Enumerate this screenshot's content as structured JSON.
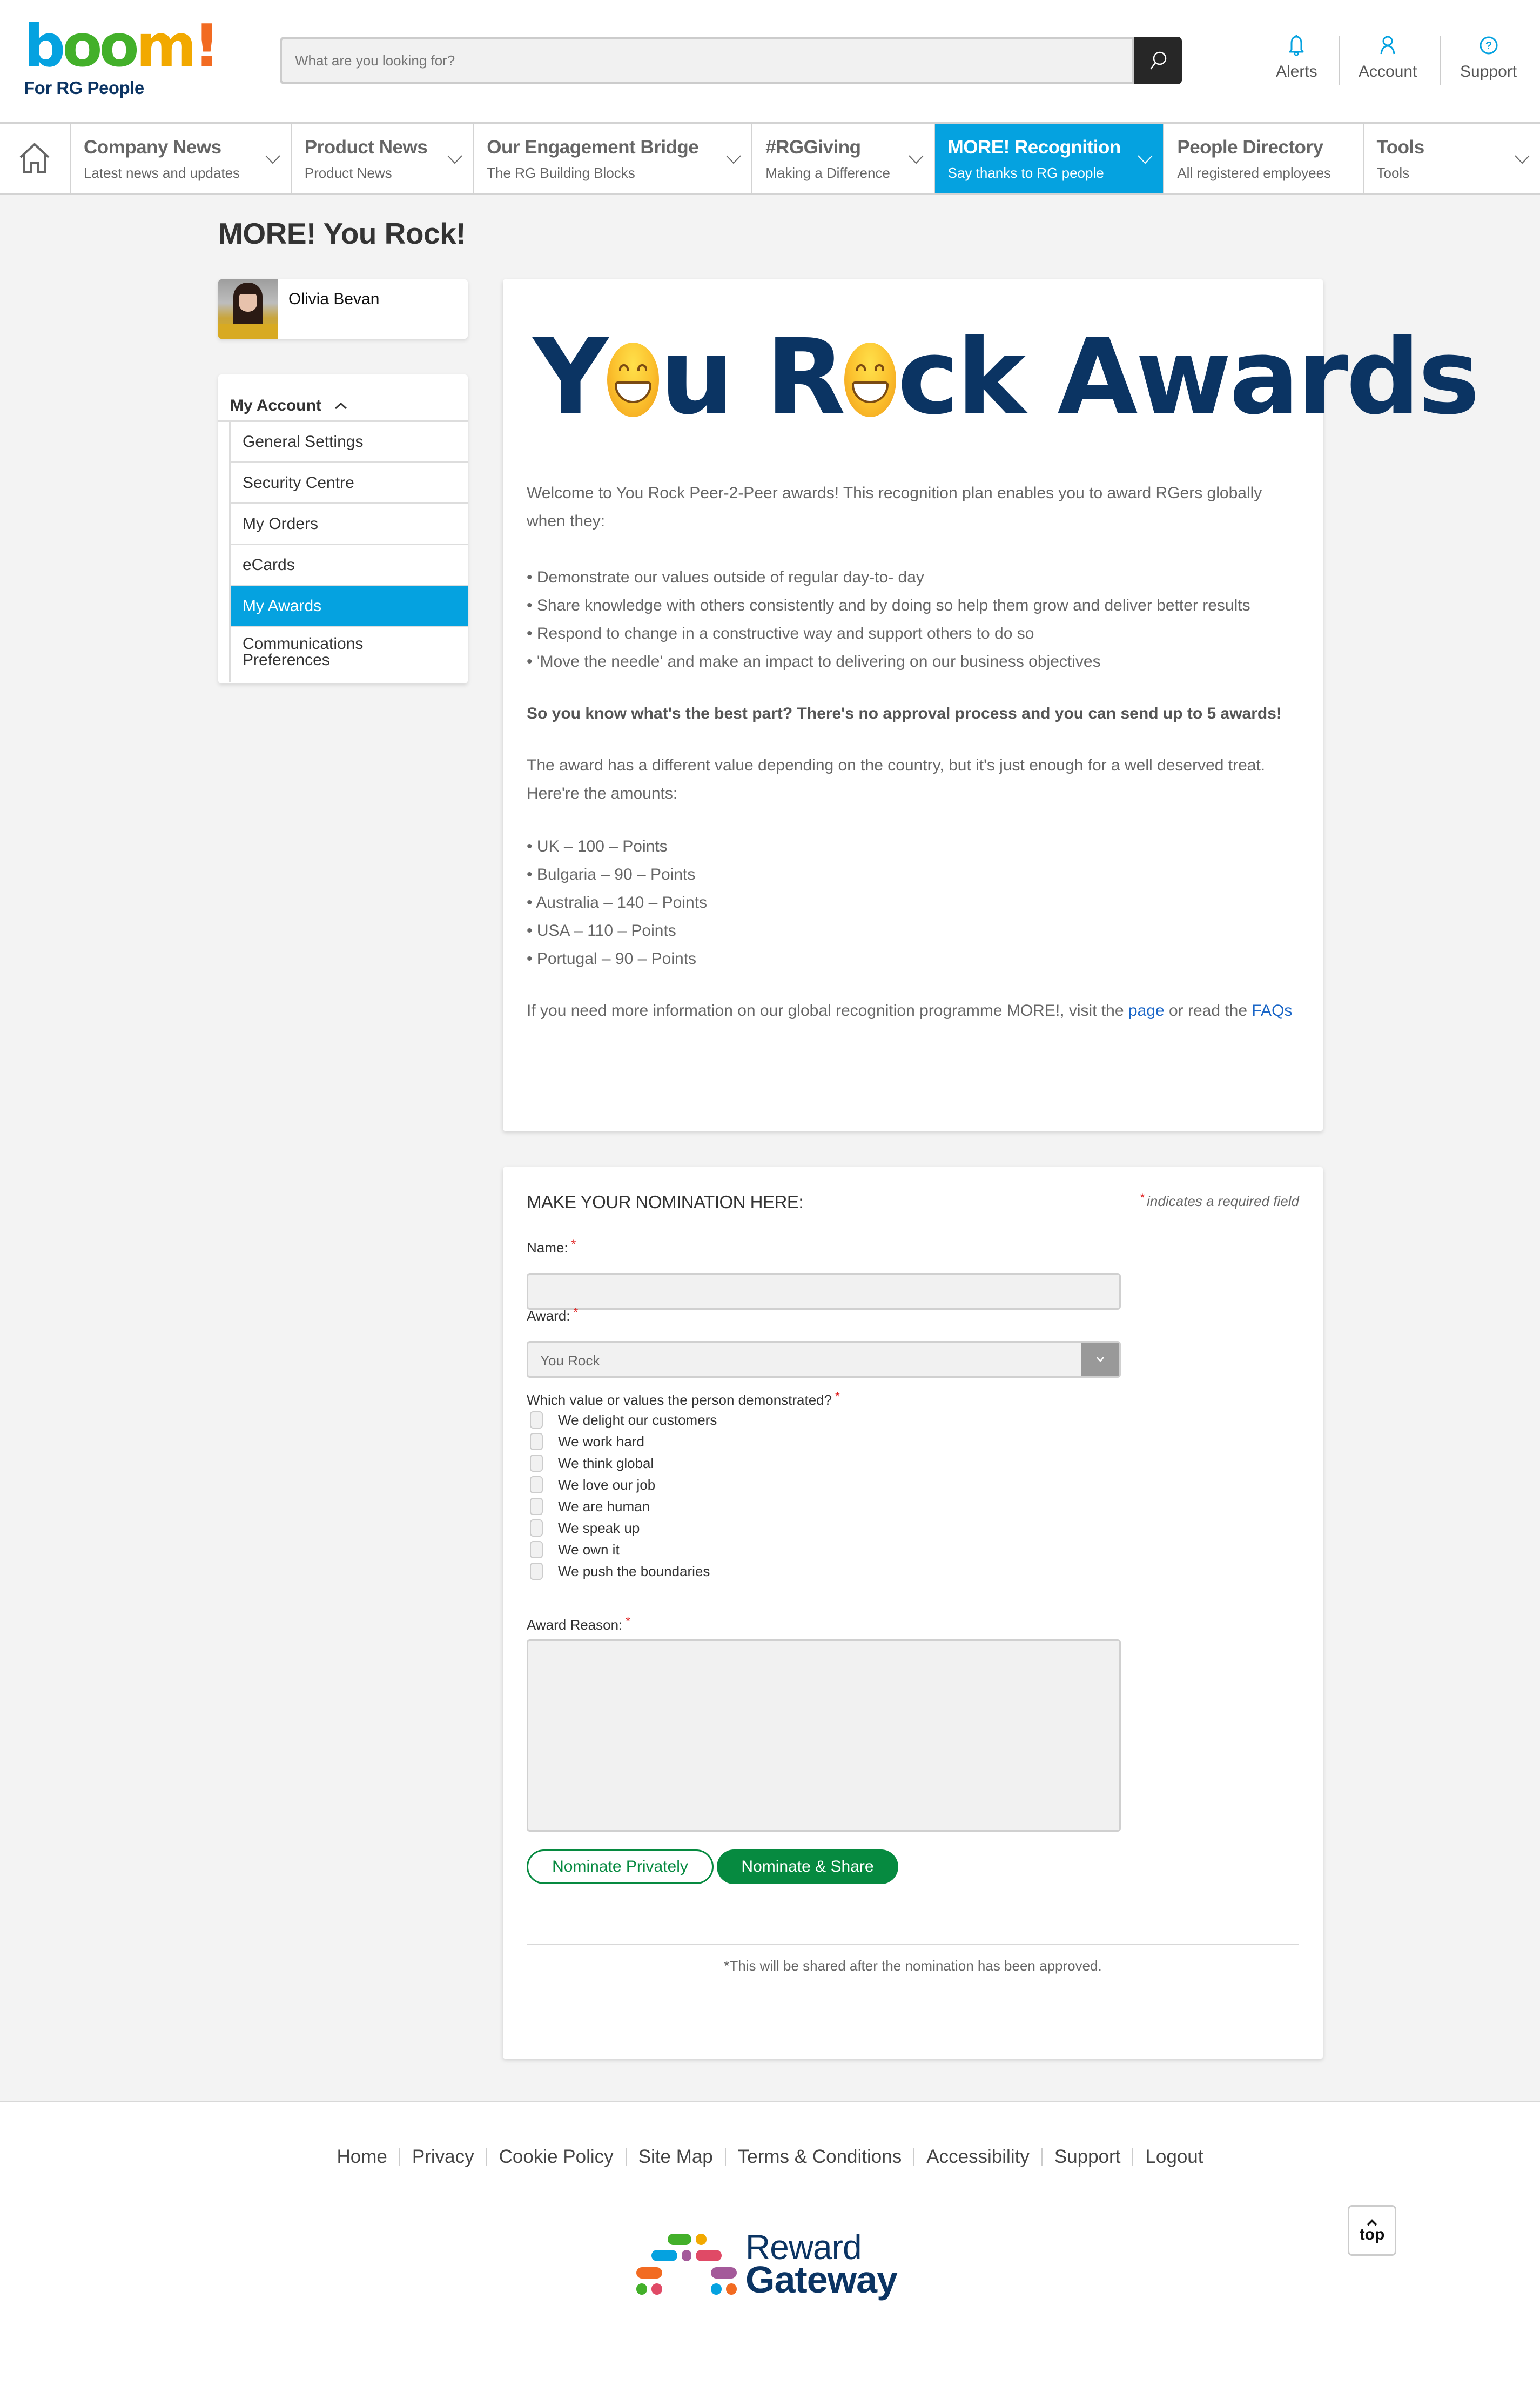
{
  "header": {
    "logo": {
      "letters": [
        "b",
        "o",
        "o",
        "m",
        "!"
      ],
      "colors": [
        "#05a2e0",
        "#43b02a",
        "#43b02a",
        "#f2a900",
        "#f26b22"
      ],
      "tagline": "For RG People"
    },
    "search": {
      "placeholder": "What are you looking for?",
      "value": ""
    },
    "utilities": [
      {
        "label": "Alerts",
        "icon": "bell-icon"
      },
      {
        "label": "Account",
        "icon": "user-icon"
      },
      {
        "label": "Support",
        "icon": "help-icon"
      }
    ],
    "accent": "#05a2e0"
  },
  "nav": {
    "home_icon": "home-icon",
    "items": [
      {
        "title": "Company News",
        "subtitle": "Latest news and updates",
        "active": false
      },
      {
        "title": "Product News",
        "subtitle": "Product News",
        "active": false
      },
      {
        "title": "Our Engagement Bridge",
        "subtitle": "The RG Building Blocks",
        "active": false
      },
      {
        "title": "#RGGiving",
        "subtitle": "Making a Difference",
        "active": false
      },
      {
        "title": "MORE! Recognition",
        "subtitle": "Say thanks to RG people",
        "active": true
      },
      {
        "title": "People Directory",
        "subtitle": "All registered employees",
        "active": false
      },
      {
        "title": "Tools",
        "subtitle": "Tools",
        "active": false
      }
    ]
  },
  "page": {
    "title": "MORE! You Rock!"
  },
  "profile": {
    "name": "Olivia Bevan"
  },
  "account_menu": {
    "title": "My Account",
    "items": [
      {
        "label": "General Settings",
        "active": false
      },
      {
        "label": "Security Centre",
        "active": false
      },
      {
        "label": "My Orders",
        "active": false
      },
      {
        "label": "eCards",
        "active": false
      },
      {
        "label": "My Awards",
        "active": true
      },
      {
        "label": "Communications Preferences",
        "active": false
      }
    ]
  },
  "info": {
    "banner": {
      "part1_pre": "Y",
      "part1_post": "u",
      "part2_pre": "R",
      "part2_post": "ck",
      "part3": "Awards"
    },
    "intro": "Welcome to You Rock Peer-2-Peer awards! This recognition plan enables you to award RGers globally when they:",
    "criteria": [
      "Demonstrate our values outside of regular day-to- day",
      "Share knowledge with others consistently and by doing so help them grow and deliver better results",
      "Respond to change in a constructive way and support others to do so",
      "'Move the needle' and make an impact to delivering on our business objectives"
    ],
    "highlight": "So you know what's the best part? There's no approval process and you can send up to 5 awards!",
    "amounts_intro": "The award has a different value depending on the country, but it's just enough for a well deserved treat. Here're the amounts:",
    "amounts": [
      {
        "country": "UK",
        "points": 100,
        "text": "UK – 100 – Points"
      },
      {
        "country": "Bulgaria",
        "points": 90,
        "text": "Bulgaria – 90 – Points"
      },
      {
        "country": "Australia",
        "points": 140,
        "text": "Australia – 140 – Points"
      },
      {
        "country": "USA",
        "points": 110,
        "text": "USA – 110 – Points"
      },
      {
        "country": "Portugal",
        "points": 90,
        "text": "Portugal – 90 – Points"
      }
    ],
    "more_info_pre": "If you need more information on our global recognition programme MORE!, visit the ",
    "more_info_link1": "page",
    "more_info_mid": " or read the ",
    "more_info_link2": "FAQs"
  },
  "form": {
    "title": "MAKE YOUR NOMINATION HERE:",
    "required_note": "indicates a required field",
    "required_mark": "*",
    "name_label": "Name:",
    "name_value": "",
    "award_label": "Award:",
    "award_value": "You Rock",
    "values_label": "Which value or values the person demonstrated?",
    "values": [
      {
        "label": "We delight our customers",
        "checked": false
      },
      {
        "label": "We work hard",
        "checked": false
      },
      {
        "label": "We think global",
        "checked": false
      },
      {
        "label": "We love our job",
        "checked": false
      },
      {
        "label": "We are human",
        "checked": false
      },
      {
        "label": "We speak up",
        "checked": false
      },
      {
        "label": "We own it",
        "checked": false
      },
      {
        "label": "We push the boundaries",
        "checked": false
      }
    ],
    "reason_label": "Award Reason:",
    "reason_value": "",
    "nominate_private_label": "Nominate Privately",
    "nominate_share_label": "Nominate & Share",
    "button_color": "#068a40",
    "share_note": "*This will be shared after the nomination has been approved."
  },
  "footer": {
    "links": [
      "Home",
      "Privacy",
      "Cookie Policy",
      "Site Map",
      "Terms & Conditions",
      "Accessibility",
      "Support",
      "Logout"
    ],
    "brand_line1": "Reward",
    "brand_line2": "Gateway",
    "top_label": "top"
  }
}
